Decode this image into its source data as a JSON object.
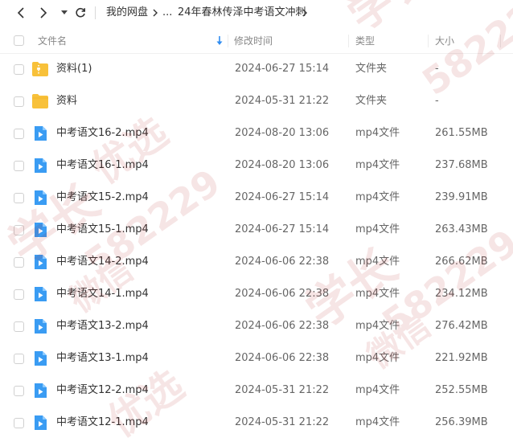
{
  "nav": {
    "breadcrumb": [
      {
        "label": "我的网盘"
      },
      {
        "label": "..."
      },
      {
        "label": "24年春林传泽中考语文冲刺"
      }
    ]
  },
  "header": {
    "name": "文件名",
    "modified": "修改时间",
    "type": "类型",
    "size": "大小"
  },
  "files": [
    {
      "name": "资料(1)",
      "modified": "2024-06-27 15:14",
      "type": "文件夹",
      "size": "-",
      "icon": "folder-zip-icon"
    },
    {
      "name": "资料",
      "modified": "2024-05-31 21:22",
      "type": "文件夹",
      "size": "-",
      "icon": "folder-icon"
    },
    {
      "name": "中考语文16-2.mp4",
      "modified": "2024-08-20 13:06",
      "type": "mp4文件",
      "size": "261.55MB",
      "icon": "video-file-icon"
    },
    {
      "name": "中考语文16-1.mp4",
      "modified": "2024-08-20 13:06",
      "type": "mp4文件",
      "size": "237.68MB",
      "icon": "video-file-icon"
    },
    {
      "name": "中考语文15-2.mp4",
      "modified": "2024-06-27 15:14",
      "type": "mp4文件",
      "size": "239.91MB",
      "icon": "video-file-icon"
    },
    {
      "name": "中考语文15-1.mp4",
      "modified": "2024-06-27 15:14",
      "type": "mp4文件",
      "size": "263.43MB",
      "icon": "video-file-icon"
    },
    {
      "name": "中考语文14-2.mp4",
      "modified": "2024-06-06 22:38",
      "type": "mp4文件",
      "size": "266.62MB",
      "icon": "video-file-icon"
    },
    {
      "name": "中考语文14-1.mp4",
      "modified": "2024-06-06 22:38",
      "type": "mp4文件",
      "size": "234.12MB",
      "icon": "video-file-icon"
    },
    {
      "name": "中考语文13-2.mp4",
      "modified": "2024-06-06 22:38",
      "type": "mp4文件",
      "size": "276.42MB",
      "icon": "video-file-icon"
    },
    {
      "name": "中考语文13-1.mp4",
      "modified": "2024-06-06 22:38",
      "type": "mp4文件",
      "size": "221.92MB",
      "icon": "video-file-icon"
    },
    {
      "name": "中考语文12-2.mp4",
      "modified": "2024-05-31 21:22",
      "type": "mp4文件",
      "size": "252.55MB",
      "icon": "video-file-icon"
    },
    {
      "name": "中考语文12-1.mp4",
      "modified": "2024-05-31 21:22",
      "type": "mp4文件",
      "size": "256.39MB",
      "icon": "video-file-icon"
    }
  ],
  "watermark": {
    "line1": "学长",
    "line2": "微信",
    "line3": "582229",
    "line4": "优选"
  },
  "colors": {
    "folder": "#f8c13a",
    "video": "#3a9cf3",
    "sort": "#2f8cf0",
    "watermark": "#b01818"
  }
}
